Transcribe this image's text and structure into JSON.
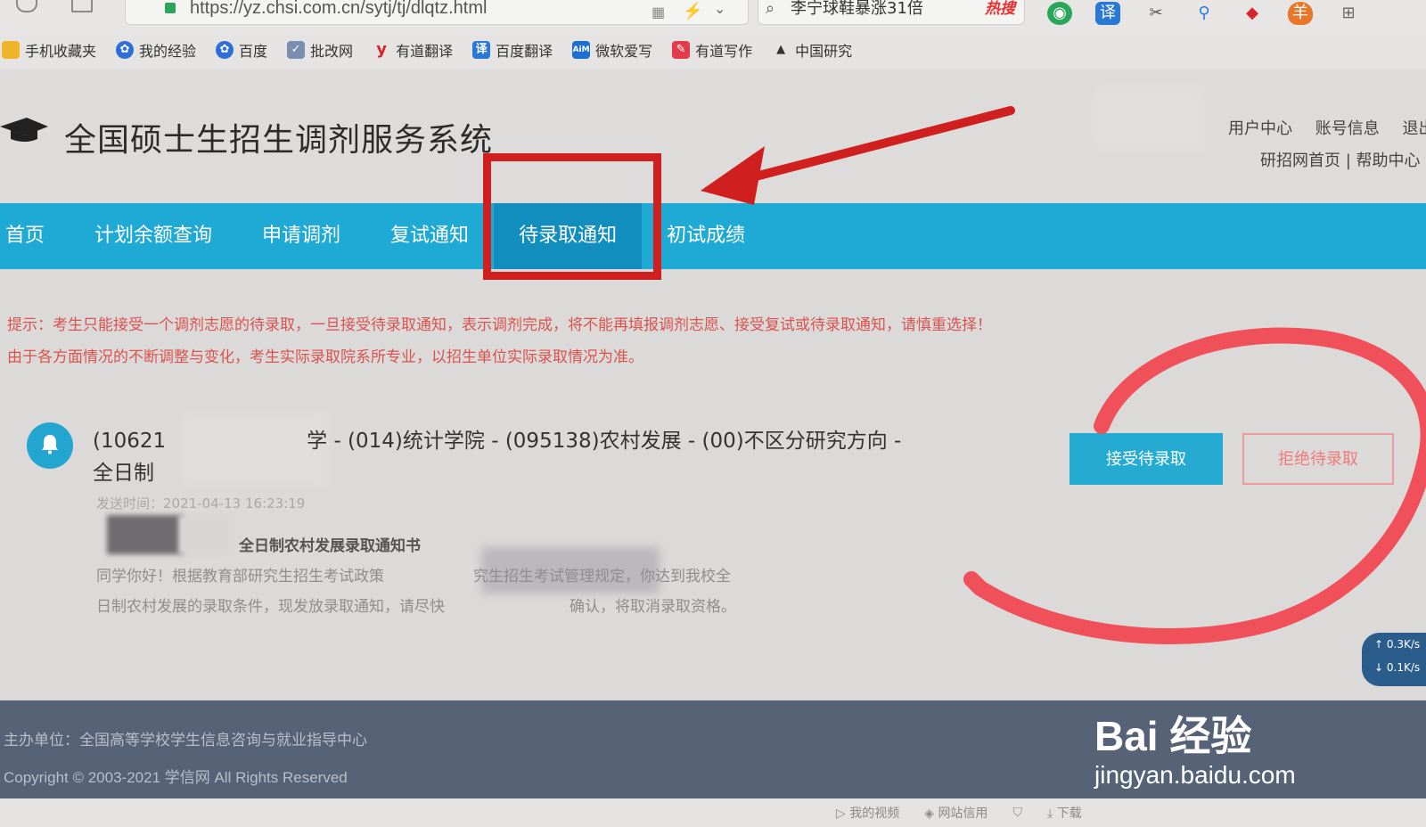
{
  "browser": {
    "url": "https://yz.chsi.com.cn/sytj/tj/dlqtz.html",
    "search_text": "李宁球鞋暴涨31倍",
    "search_hot_tag": "热搜",
    "bookmarks": [
      {
        "label": "手机收藏夹",
        "icon": "folder-icon",
        "color": "#f0b429"
      },
      {
        "label": "我的经验",
        "icon": "baidu-paw-icon",
        "color": "#2d6fd6"
      },
      {
        "label": "百度",
        "icon": "baidu-paw-icon",
        "color": "#2d6fd6"
      },
      {
        "label": "批改网",
        "icon": "pigai-icon",
        "color": "#7a8fb0"
      },
      {
        "label": "有道翻译",
        "icon": "youdao-icon",
        "color": "#d9222a"
      },
      {
        "label": "百度翻译",
        "icon": "translate-icon",
        "color": "#2a78d6"
      },
      {
        "label": "微软爱写",
        "icon": "aim-icon",
        "color": "#1f6fd1"
      },
      {
        "label": "有道写作",
        "icon": "youdao-write-icon",
        "color": "#e33b4a"
      },
      {
        "label": "中国研究",
        "icon": "graduation-cap-icon",
        "color": "#333333"
      }
    ]
  },
  "header": {
    "site_title": "全国硕士生招生调剂服务系统",
    "links_row1": [
      "用户中心",
      "账号信息",
      "退出"
    ],
    "links_row2": "研招网首页 | 帮助中心"
  },
  "nav": {
    "items": [
      "首页",
      "计划余额查询",
      "申请调剂",
      "复试通知",
      "待录取通知",
      "初试成绩"
    ],
    "active_index": 4
  },
  "tips": {
    "line1": "提示：考生只能接受一个调剂志愿的待录取，一旦接受待录取通知，表示调剂完成，将不能再填报调剂志愿、接受复试或待录取通知，请慎重选择！",
    "line2": "由于各方面情况的不断调整与变化，考生实际录取院系所专业，以招生单位实际录取情况为准。"
  },
  "notice": {
    "title_prefix": "(10621",
    "title_rest": "学 - (014)统计学院 - (095138)农村发展 - (00)不区分研究方向 -",
    "title_line2": "全日制",
    "send_time": "发送时间：2021-04-13 16:23:19",
    "letter_title": "全日制农村发展录取通知书",
    "letter_line1": "同学你好！根据教育部研究生招生考试政策",
    "letter_line1b": "究生招生考试管理规定，你达到我校全",
    "letter_line2": "日制农村发展的录取条件，现发放录取通知，请尽快",
    "letter_line2b": "确认，将取消录取资格。",
    "accept_label": "接受待录取",
    "reject_label": "拒绝待录取"
  },
  "speed": {
    "up": "0.3K/s",
    "down": "0.1K/s"
  },
  "footer": {
    "org": "主办单位：全国高等学校学生信息咨询与就业指导中心",
    "copyright": "Copyright © 2003-2021 学信网 All Rights Reserved"
  },
  "status_bar": [
    "我的视频",
    "网站信用",
    "下载"
  ],
  "watermark": {
    "logo": "Bai 经验",
    "url": "jingyan.baidu.com"
  },
  "colors": {
    "nav_bg": "#1fa9d5",
    "nav_active": "#118dbe",
    "tip_text": "#d9534f",
    "accept_btn": "#25abd1",
    "annotation_red": "#cf1f1f",
    "footer_bg": "#566276"
  }
}
